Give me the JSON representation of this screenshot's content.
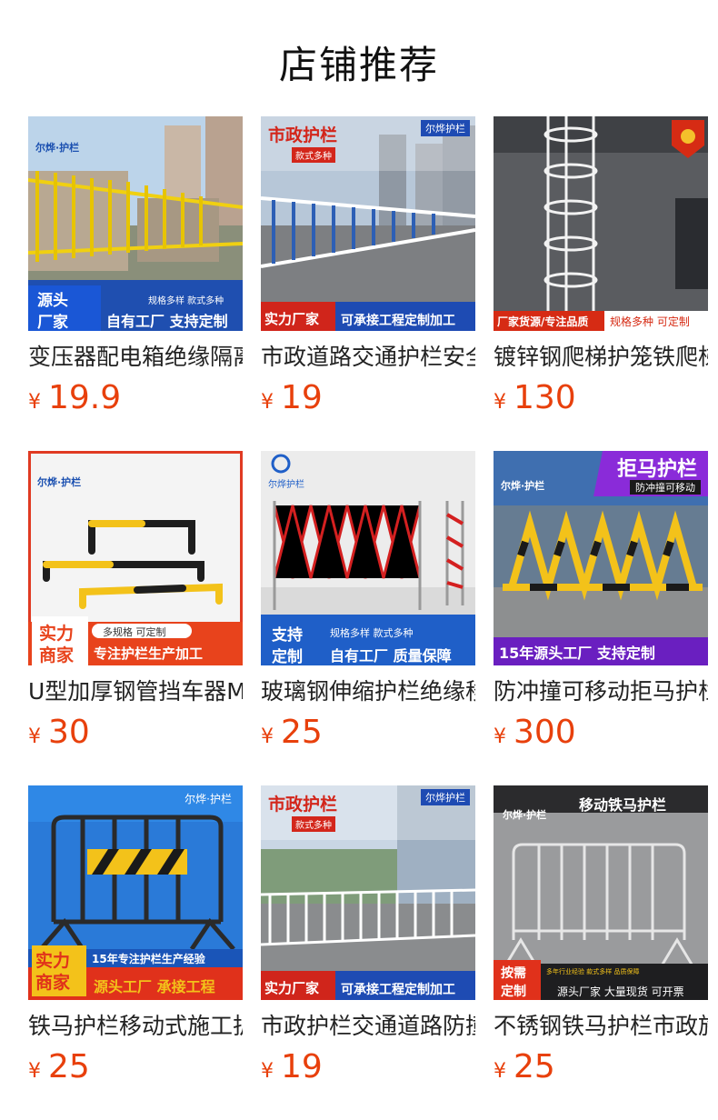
{
  "shop": {
    "title": "店铺推荐"
  },
  "products": [
    {
      "name": "变压器配电箱绝缘隔离护栏",
      "currency": "¥",
      "price": "19.9",
      "img": {
        "logo": "尔烨·护栏",
        "tag_left": "源头",
        "tag_left2": "厂家",
        "sub": "规格多样 款式多种",
        "bottom": "自有工厂 支持定制"
      }
    },
    {
      "name": "市政道路交通护栏安全隔离",
      "currency": "¥",
      "price": "19",
      "img": {
        "logo": "尔烨护栏",
        "title": "市政护栏",
        "sub": "款式多种",
        "tag_left": "实力厂家",
        "bottom": "可承接工程定制加工"
      }
    },
    {
      "name": "镀锌钢爬梯护笼铁爬梯",
      "currency": "¥",
      "price": "130",
      "img": {
        "tag_left": "厂家货源/专注品质",
        "bottom": "规格多种 可定制"
      }
    },
    {
      "name": "U型加厚钢管挡车器M型",
      "currency": "¥",
      "price": "30",
      "img": {
        "logo": "尔烨·护栏",
        "tag_left": "实力",
        "tag_left2": "商家",
        "sub": "多规格 可定制",
        "bottom": "专注护栏生产加工"
      }
    },
    {
      "name": "玻璃钢伸缩护栏绝缘移动",
      "currency": "¥",
      "price": "25",
      "img": {
        "logo": "尔烨护栏",
        "tag_left": "支持",
        "tag_left2": "定制",
        "sub": "规格多样 款式多种",
        "bottom": "自有工厂 质量保障"
      }
    },
    {
      "name": "防冲撞可移动拒马护栏",
      "currency": "¥",
      "price": "300",
      "img": {
        "logo": "尔烨·护栏",
        "title": "拒马护栏",
        "sub": "防冲撞可移动",
        "bottom": "15年源头工厂 支持定制"
      }
    },
    {
      "name": "铁马护栏移动式施工护栏",
      "currency": "¥",
      "price": "25",
      "img": {
        "logo": "尔烨·护栏",
        "tag_left": "实力",
        "tag_left2": "商家",
        "sub": "15年专注护栏生产经验",
        "bottom": "源头工厂 承接工程"
      }
    },
    {
      "name": "市政护栏交通道路防撞",
      "currency": "¥",
      "price": "19",
      "img": {
        "logo": "尔烨护栏",
        "title": "市政护栏",
        "sub": "款式多种",
        "tag_left": "实力厂家",
        "bottom": "可承接工程定制加工"
      }
    },
    {
      "name": "不锈钢铁马护栏市政施工",
      "currency": "¥",
      "price": "25",
      "img": {
        "logo": "尔烨·护栏",
        "title": "移动铁马护栏",
        "tag_left": "按需",
        "tag_left2": "定制",
        "sub": "多年行业经验 款式多样 品质保障",
        "bottom": "源头厂家 大量现货 可开票"
      }
    }
  ]
}
